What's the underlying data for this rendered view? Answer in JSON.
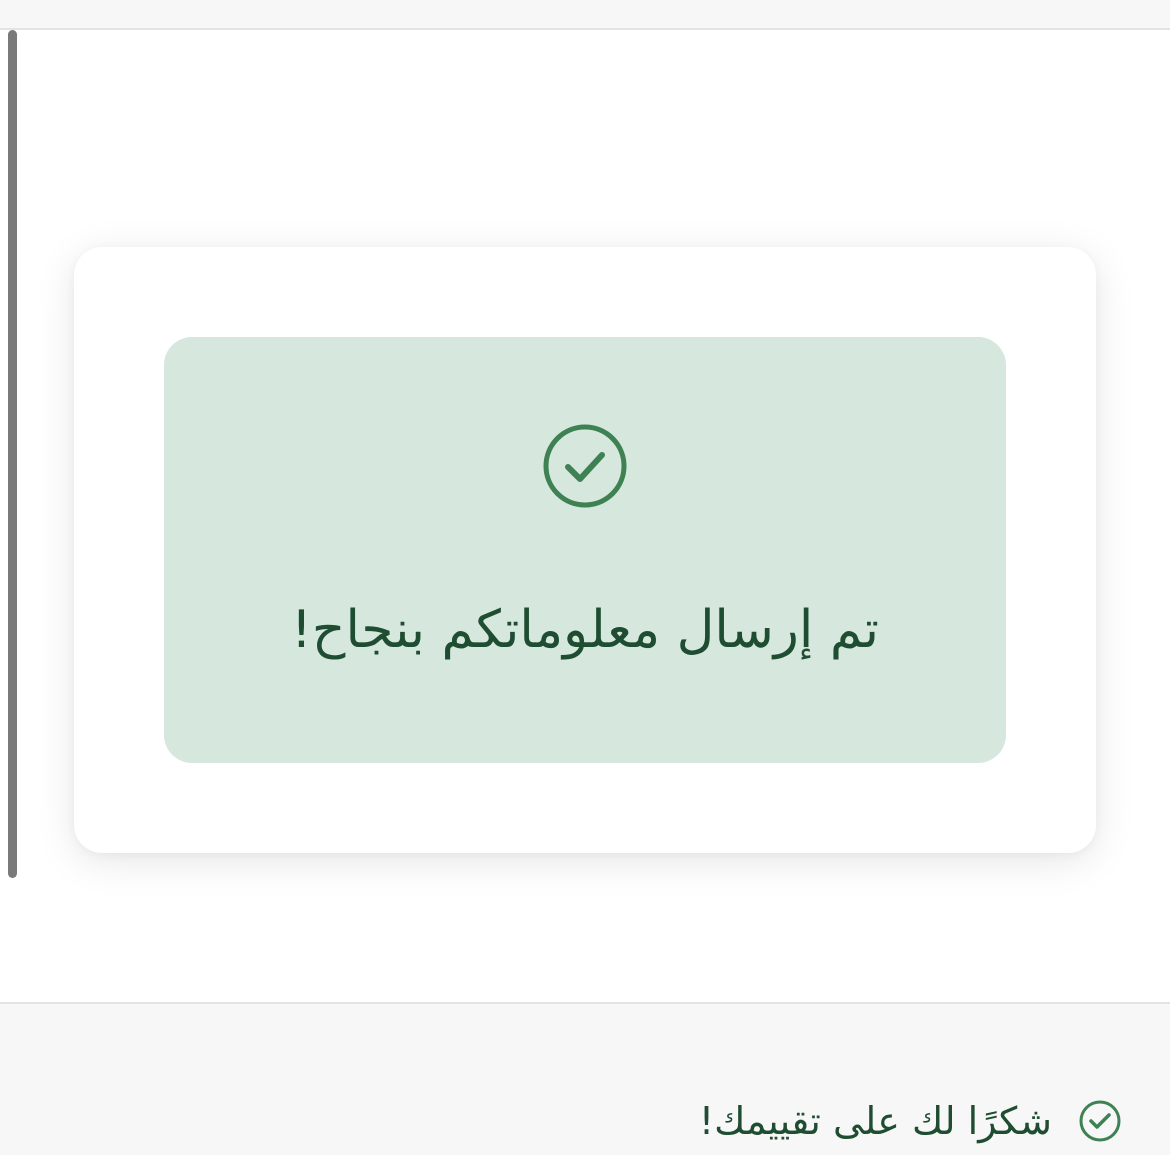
{
  "success": {
    "icon": "check-circle-icon",
    "message": "تم إرسال معلوماتكم بنجاح!"
  },
  "feedback": {
    "icon": "check-circle-icon",
    "message": "شكرًا لك على تقييمك!"
  },
  "colors": {
    "panel_bg": "#d6e7dd",
    "text_dark_green": "#1e4d31",
    "icon_green": "#3e8152",
    "footer_bg": "#f7f7f7"
  }
}
